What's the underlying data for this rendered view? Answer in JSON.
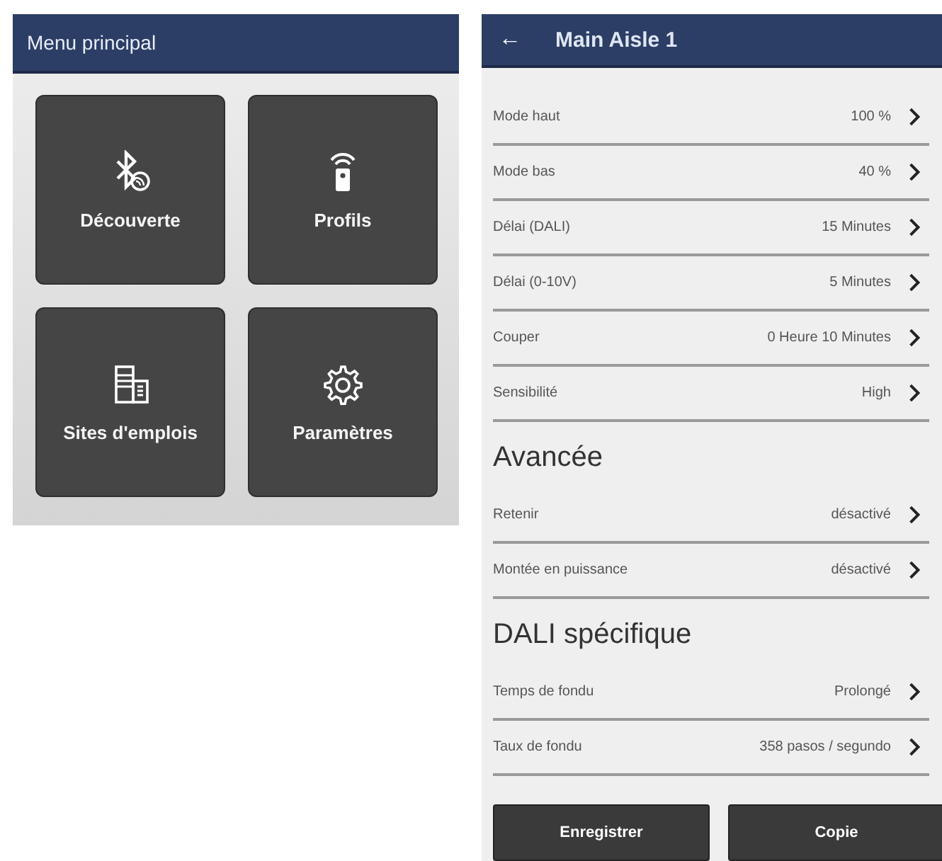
{
  "main_menu": {
    "title": "Menu principal",
    "tiles": [
      {
        "label": "Découverte",
        "kind": "bluetooth"
      },
      {
        "label": "Profils",
        "kind": "remote"
      },
      {
        "label": "Sites d'emplois",
        "kind": "buildings"
      },
      {
        "label": "Paramètres",
        "kind": "gear"
      }
    ]
  },
  "detail": {
    "back": "←",
    "title": "Main Aisle 1",
    "sections": [
      {
        "rows": [
          {
            "label": "Mode haut",
            "value": "100 %"
          },
          {
            "label": "Mode bas",
            "value": "40 %"
          },
          {
            "label": "Délai (DALI)",
            "value": "15 Minutes"
          },
          {
            "label": "Délai (0-10V)",
            "value": "5 Minutes"
          },
          {
            "label": "Couper",
            "value": "0 Heure 10 Minutes"
          },
          {
            "label": "Sensibilité",
            "value": "High"
          }
        ]
      },
      {
        "heading": "Avancée",
        "rows": [
          {
            "label": "Retenir",
            "value": "désactivé"
          },
          {
            "label": "Montée en puissance",
            "value": "désactivé"
          }
        ]
      },
      {
        "heading": "DALI spécifique",
        "rows": [
          {
            "label": "Temps de fondu",
            "value": "Prolongé"
          },
          {
            "label": "Taux de fondu",
            "value": "358 pasos / segundo"
          }
        ]
      }
    ],
    "buttons": [
      "Enregistrer",
      "Copie"
    ]
  }
}
